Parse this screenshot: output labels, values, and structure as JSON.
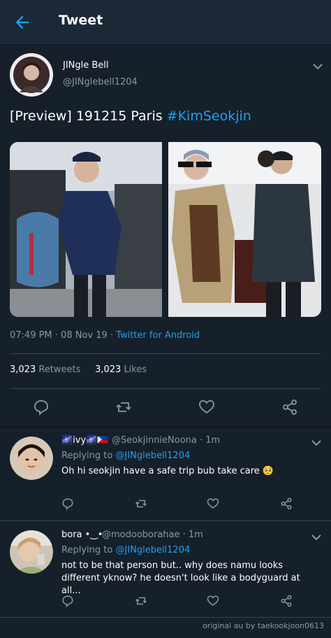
{
  "header": {
    "title": "Tweet"
  },
  "tweet": {
    "author_name": "JINgle Bell",
    "author_handle": "@JINglebell1204",
    "text_plain": "[Preview] 191215 Paris ",
    "hashtag": "#KimSeokjin",
    "time": "07:49 PM · 08 Nov 19 · ",
    "source": "Twitter for Android",
    "retweets_count": "3,023",
    "retweets_label": "Retweets",
    "likes_count": "3,023",
    "likes_label": "Likes"
  },
  "replies": [
    {
      "name": "🌌ivy🌌🇵🇭",
      "handle": "@SeokjinnieNoona · 1m",
      "replying_label": "Replying to ",
      "replying_handle": "@JINglebell1204",
      "text": "Oh hi seokjin have a safe trip bub take care 🥺"
    },
    {
      "name": "bora •‿•",
      "handle": "@modooborahae · 1m",
      "replying_label": "Replying to ",
      "replying_handle": "@JINglebell1204",
      "text": "not to be that person but.. why does namu looks different yknow? he doesn't look like a bodyguard at all..."
    }
  ],
  "footer": {
    "credit": "original au by taekookjoon0613"
  },
  "colors": {
    "background": "#15202b",
    "accent": "#1da1f2",
    "muted": "#8899a6",
    "divider": "#38444d"
  }
}
